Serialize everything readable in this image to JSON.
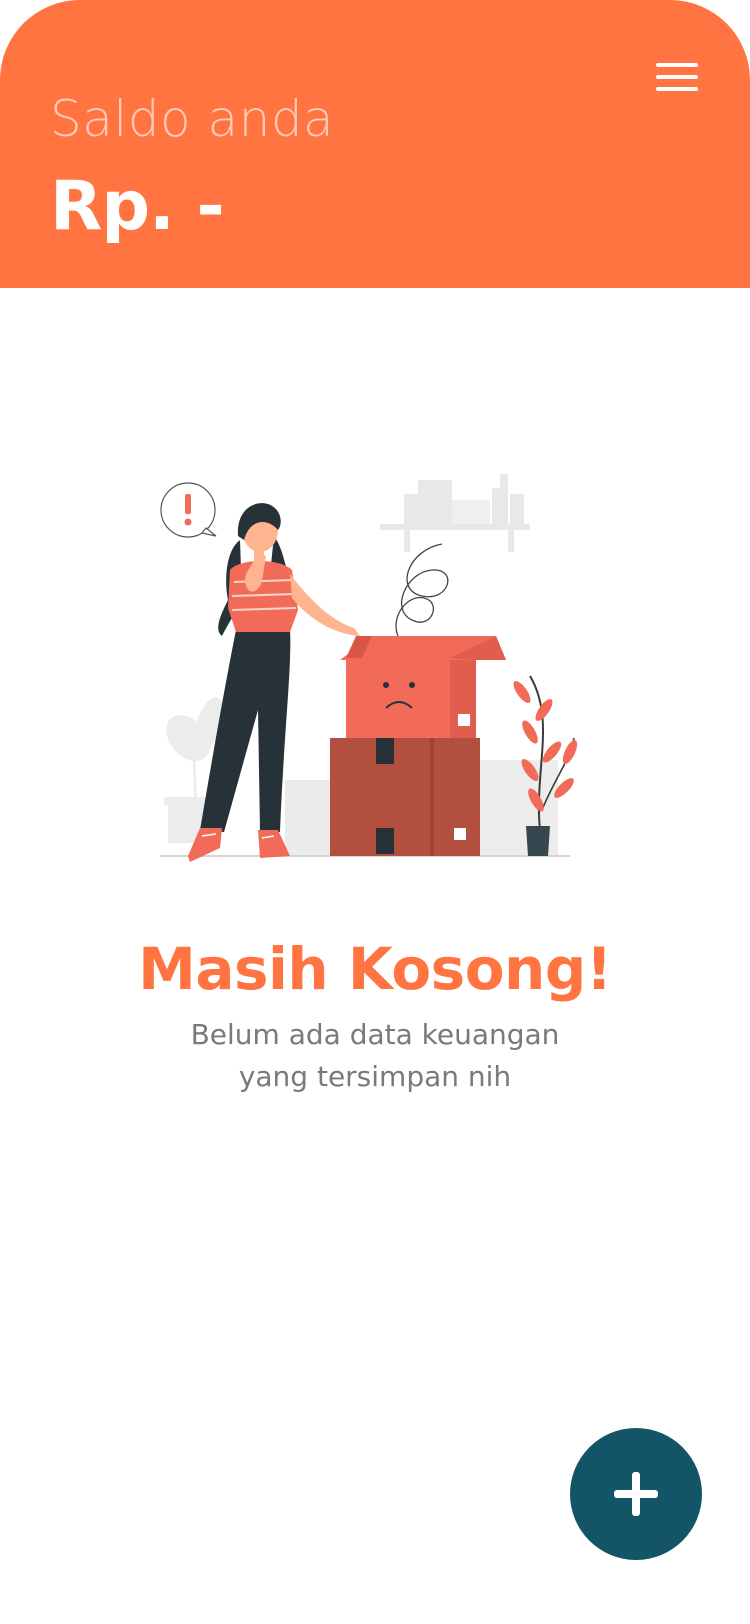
{
  "colors": {
    "accent": "#ff7440",
    "fab": "#135466",
    "box_light": "#f26b59",
    "box_dark": "#b34f3f",
    "hair_pants": "#263238",
    "skin": "#ffb48f"
  },
  "header": {
    "balance_label": "Saldo anda",
    "balance_value": "Rp. -",
    "menu_icon": "hamburger-menu-icon"
  },
  "empty_state": {
    "illustration": "empty-box-illustration",
    "title": "Masih Kosong!",
    "description_line1": "Belum ada data keuangan",
    "description_line2": "yang tersimpan nih"
  },
  "fab": {
    "icon": "plus-icon"
  }
}
